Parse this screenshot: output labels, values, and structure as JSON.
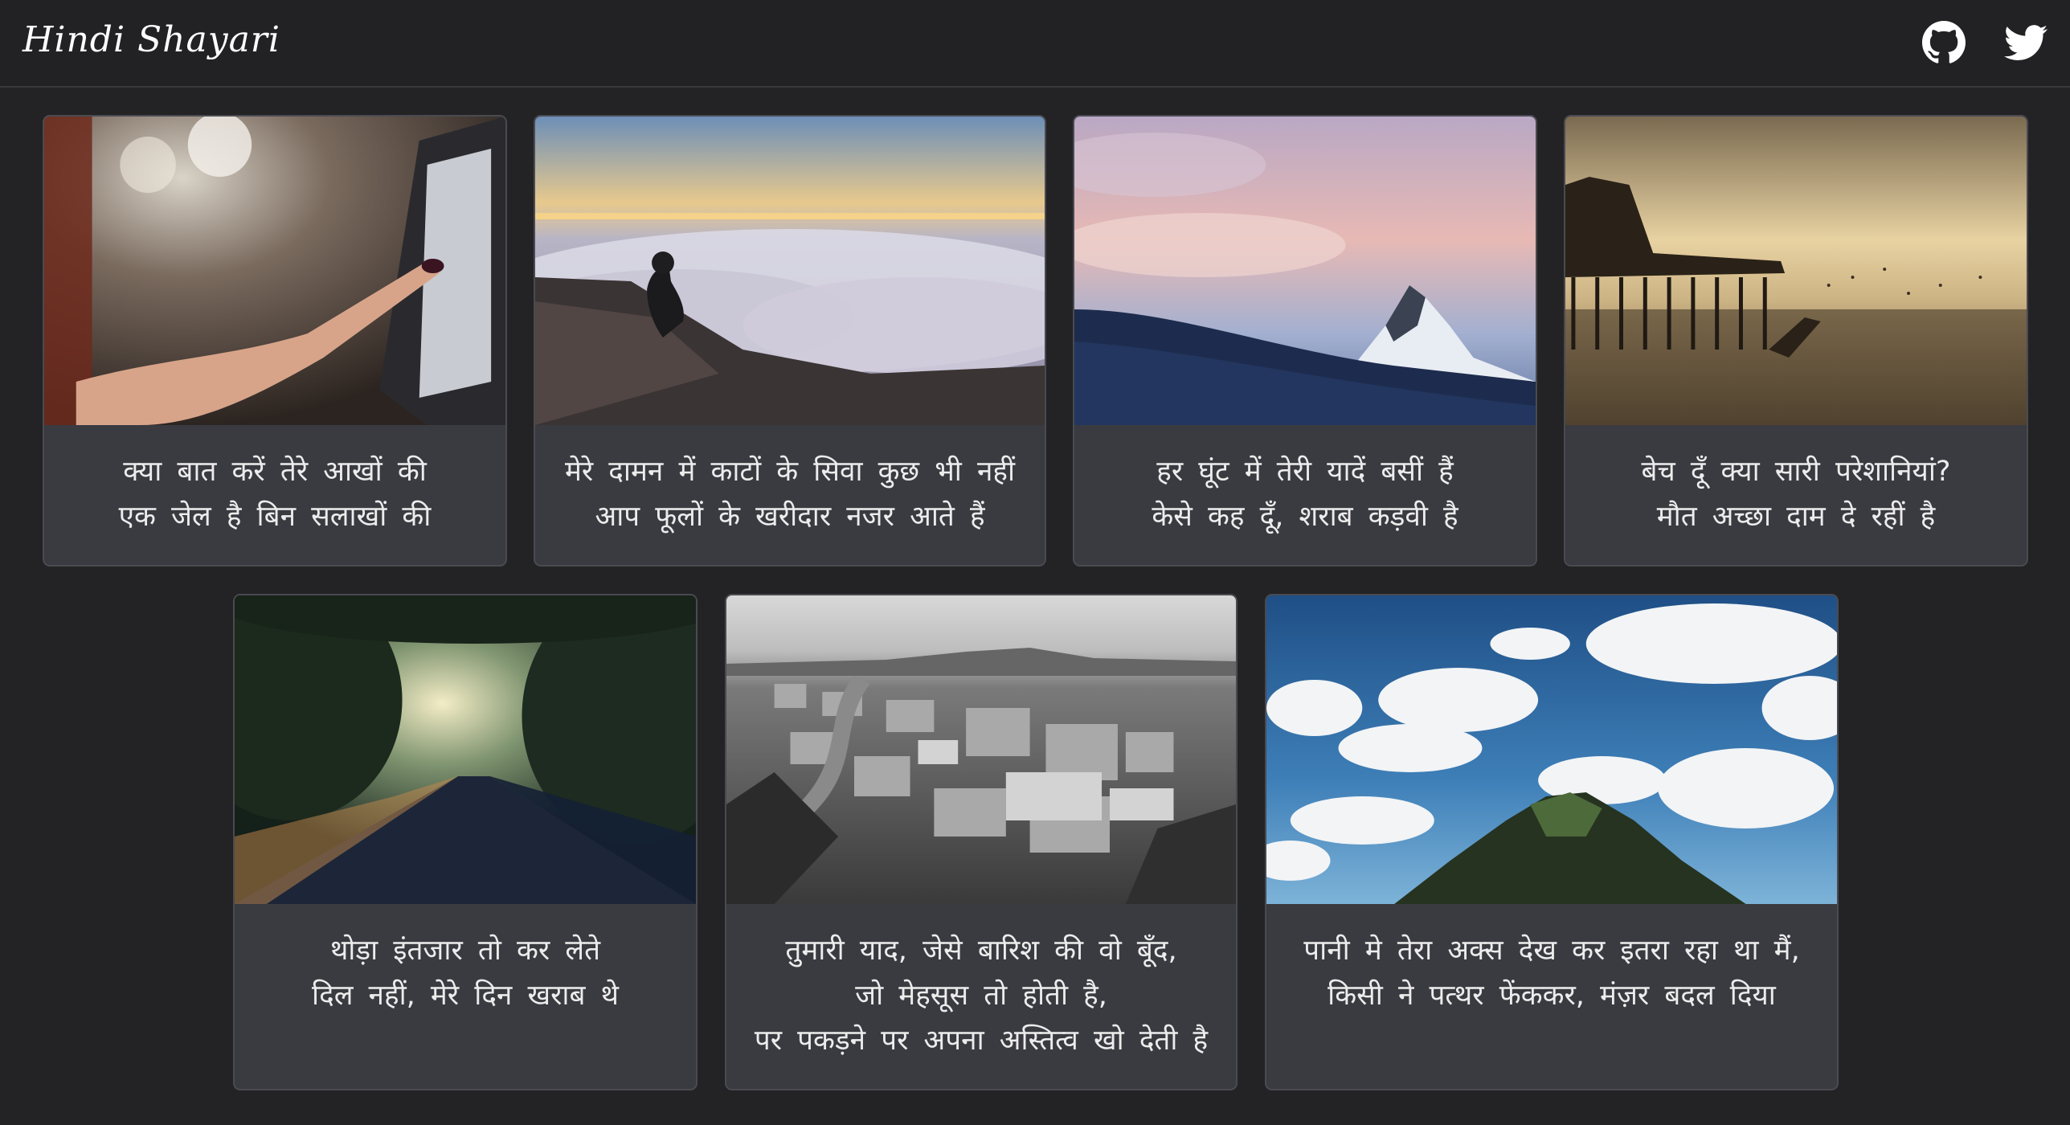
{
  "header": {
    "brand": "Hindi Shayari",
    "icons": [
      "github-icon",
      "twitter-icon"
    ]
  },
  "cards": [
    {
      "image": "hand-tablet-photo",
      "lines": [
        "क्या बात करें तेरे आखों की",
        "एक जेल है बिन सलाखों की"
      ]
    },
    {
      "image": "man-above-clouds-photo",
      "lines": [
        "मेरे दामन में काटों के सिवा कुछ भी नहीं",
        "आप फूलों के खरीदार नजर आते हैं"
      ]
    },
    {
      "image": "snowy-peak-photo",
      "lines": [
        "हर घूंट में तेरी यादें बसीं हैं",
        "केसे कह दूँ, शराब कड़वी है"
      ]
    },
    {
      "image": "ruined-pier-photo",
      "lines": [
        "बेच दूँ क्या सारी परेशानियां?",
        "मौत अच्छा दाम दे रहीं है"
      ]
    },
    {
      "image": "forest-road-photo",
      "lines": [
        "थोड़ा इंतजार तो कर लेते",
        "दिल नहीं, मेरे दिन खराब थे"
      ]
    },
    {
      "image": "city-aerial-photo",
      "lines": [
        "तुमारी याद, जेसे बारिश की वो बूँद,",
        "जो मेहसूस तो होती है,",
        "पर पकड़ने पर अपना अस्तित्व खो देती है"
      ]
    },
    {
      "image": "sky-clouds-cliff-photo",
      "lines": [
        "पानी मे तेरा अक्स देख कर इतरा रहा था मैं,",
        "किसी ने पत्थर फेंककर, मंज़र बदल दिया"
      ]
    }
  ],
  "colors": {
    "background": "#232325",
    "card": "#3a3a41",
    "text": "#ececec"
  }
}
